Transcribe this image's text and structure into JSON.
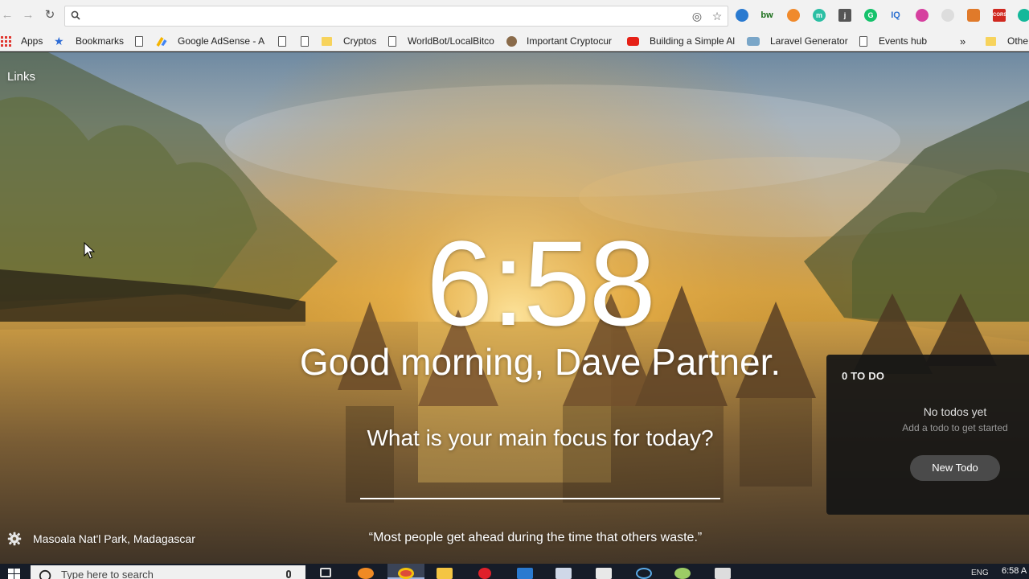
{
  "browser": {
    "address_value": "",
    "bookmarks": [
      {
        "label": "Apps",
        "icon": "apps-grid-icon"
      },
      {
        "label": "Bookmarks",
        "icon": "star-icon"
      },
      {
        "label": "",
        "icon": "page-icon"
      },
      {
        "label": "Google AdSense - A",
        "icon": "adsense-icon"
      },
      {
        "label": "",
        "icon": "page-icon"
      },
      {
        "label": "",
        "icon": "page-icon"
      },
      {
        "label": "Cryptos",
        "icon": "folder-icon"
      },
      {
        "label": "WorldBot/LocalBitco",
        "icon": "page-icon"
      },
      {
        "label": "Important Cryptocur",
        "icon": "site-icon"
      },
      {
        "label": "Building a Simple Al",
        "icon": "youtube-icon"
      },
      {
        "label": "Laravel Generator",
        "icon": "laravel-icon"
      },
      {
        "label": "Events hub",
        "icon": "page-icon"
      },
      {
        "label": "»",
        "icon": ""
      },
      {
        "label": "Othe",
        "icon": "folder-icon"
      }
    ],
    "extension_letters": [
      "",
      "bw",
      "",
      "m",
      "j",
      "G",
      "IQ",
      "",
      "",
      "",
      "CORS",
      ""
    ]
  },
  "momentum": {
    "links_label": "Links",
    "time": "6:58",
    "greeting": "Good morning, Dave Partner.",
    "focus_question": "What is your main focus for today?",
    "quote": "“Most people get ahead during the time that others waste.”",
    "photo_location": "Masoala Nat'l Park, Madagascar",
    "todo": {
      "count_label": "0 TO DO",
      "empty_title": "No todos yet",
      "empty_subtitle": "Add a todo to get started",
      "new_button": "New Todo"
    }
  },
  "taskbar": {
    "search_placeholder": "Type here to search",
    "language": "ENG",
    "clock": "6:58 A"
  }
}
